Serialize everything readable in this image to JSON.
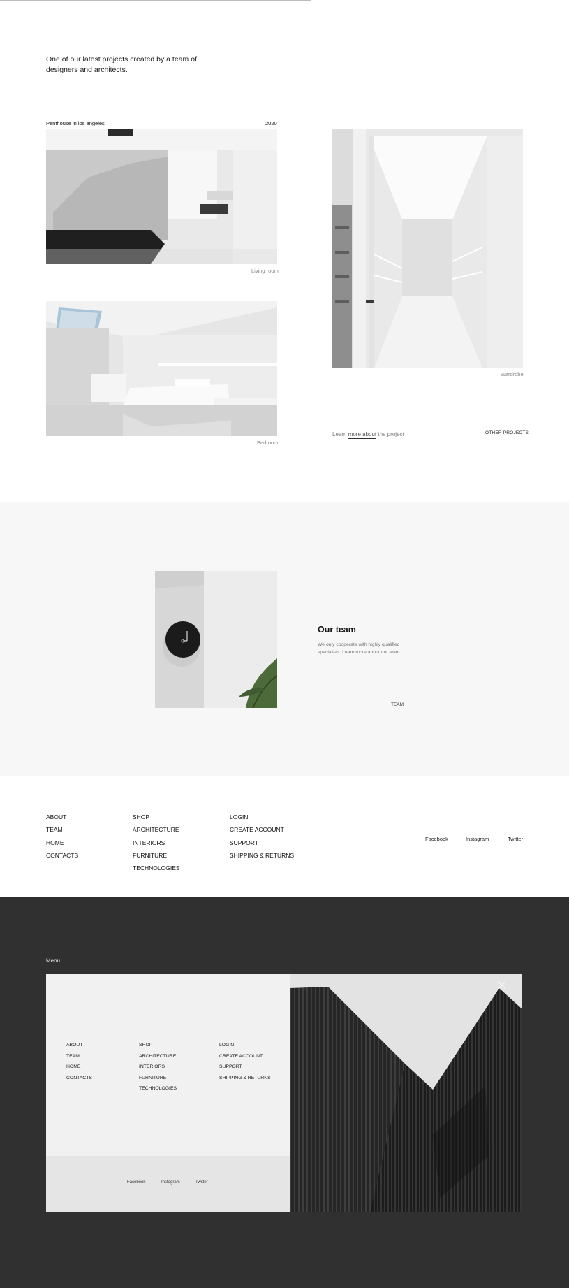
{
  "intro": "One of our latest projects created by a team of designers and architects.",
  "project": {
    "name": "Penthouse in los angeles",
    "year": "2020"
  },
  "captions": {
    "living": "Living room",
    "bedroom": "Bedroom",
    "wardrobe": "Wardrobe"
  },
  "links": {
    "learn_pre": "Learn ",
    "learn_u": "more about",
    "learn_post": " the project",
    "other": "OTHER PROJECTS"
  },
  "team": {
    "title": "Our team",
    "text": "We only cooperate with highly qualified specialists. Learn more about our team.",
    "link": "TEAM"
  },
  "footer": {
    "col1": [
      "ABOUT",
      "TEAM",
      "HOME",
      "CONTACTS"
    ],
    "col2": [
      "SHOP",
      "ARCHITECTURE",
      "INTERIORS",
      "FURNITURE",
      "TECHNOLOGIES"
    ],
    "col3": [
      "LOGIN",
      "CREATE ACCOUNT",
      "SUPPORT",
      "SHIPPING & RETURNS"
    ],
    "social": [
      "Facebook",
      "Instagram",
      "Twitter"
    ]
  },
  "menu": {
    "label": "Menu",
    "col1": [
      "ABOUT",
      "TEAM",
      "HOME",
      "CONTACTS"
    ],
    "col2": [
      "SHOP",
      "ARCHITECTURE",
      "INTERIORS",
      "FURNITURE",
      "TECHNOLOGIES"
    ],
    "col3": [
      "LOGIN",
      "CREATE ACCOUNT",
      "SUPPORT",
      "SHIPPING & RETURNS"
    ],
    "social": [
      "Facebook",
      "Instagram",
      "Twitter"
    ],
    "close_icon": "close-icon"
  }
}
